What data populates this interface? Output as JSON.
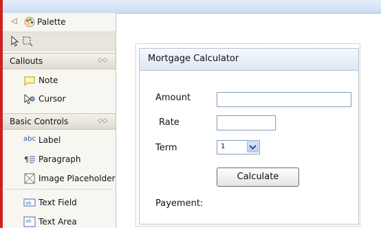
{
  "palette": {
    "title": "Palette",
    "drawers": [
      {
        "label": "Callouts",
        "items": [
          {
            "label": "Note",
            "icon": "note-icon"
          },
          {
            "label": "Cursor",
            "icon": "cursor-icon"
          }
        ]
      },
      {
        "label": "Basic Controls",
        "items": [
          {
            "label": "Label",
            "icon": "abc-label-icon",
            "icon_text": "abc"
          },
          {
            "label": "Paragraph",
            "icon": "paragraph-icon"
          },
          {
            "label": "Image Placeholder",
            "icon": "image-placeholder-icon"
          },
          {
            "label": "Text Field",
            "icon": "text-field-icon"
          },
          {
            "label": "Text Area",
            "icon": "text-area-icon"
          }
        ]
      }
    ]
  },
  "form": {
    "title": "Mortgage Calculator",
    "amount_label": "Amount",
    "amount_value": "",
    "rate_label": "Rate",
    "rate_value": "",
    "term_label": "Term",
    "term_value": "1",
    "calculate_label": "Calculate",
    "payment_label": "Payement:"
  }
}
